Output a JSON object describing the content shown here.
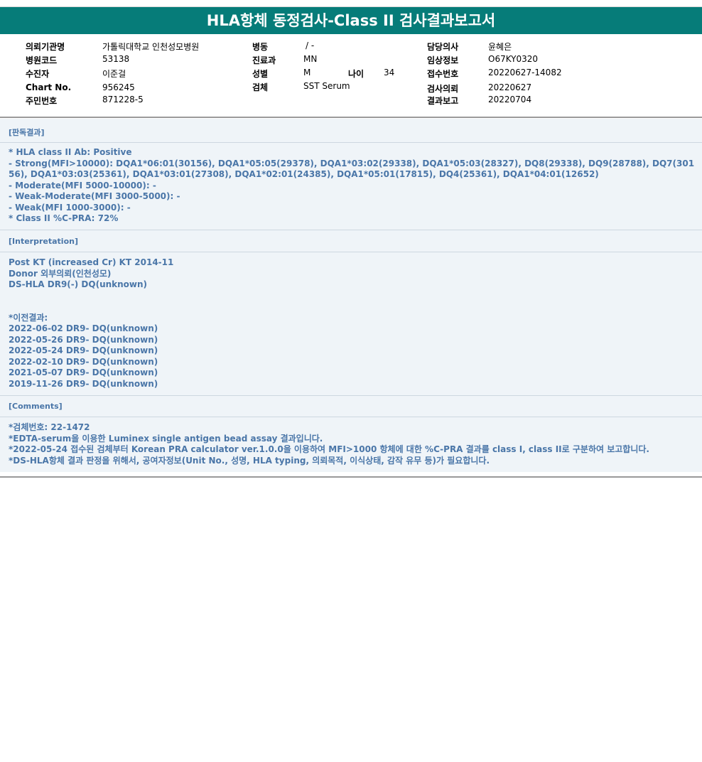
{
  "title": "HLA항체 동정검사-Class II 검사결과보고서",
  "header": {
    "col1": [
      {
        "label": "의뢰기관명",
        "value": "가톨릭대학교 인천성모병원"
      },
      {
        "label": "병원코드",
        "value": "53138"
      },
      {
        "label": "수진자",
        "value": "이준걸"
      },
      {
        "label": "Chart No.",
        "value": "956245"
      },
      {
        "label": "주민번호",
        "value": "871228-5"
      }
    ],
    "col2": [
      {
        "label": "병동",
        "value": "/ -"
      },
      {
        "label": "진료과",
        "value": "MN"
      },
      {
        "label": "성별",
        "value": "M"
      },
      {
        "label": "검체",
        "value": "SST Serum"
      }
    ],
    "age": {
      "label": "나이",
      "value": "34"
    },
    "col3": [
      {
        "label": "담당의사",
        "value": "윤혜은"
      },
      {
        "label": "임상정보",
        "value": "O67KY0320"
      },
      {
        "label": "접수번호",
        "value": "20220627-14082"
      },
      {
        "label": "검사의뢰",
        "value": "20220627"
      },
      {
        "label": "결과보고",
        "value": "20220704"
      }
    ]
  },
  "sections": {
    "result": {
      "title": "[판독결과]",
      "body": "* HLA class II Ab: Positive\n- Strong(MFI>10000): DQA1*06:01(30156), DQA1*05:05(29378), DQA1*03:02(29338), DQA1*05:03(28327), DQ8(29338), DQ9(28788), DQ7(30156), DQA1*03:03(25361), DQA1*03:01(27308), DQA1*02:01(24385), DQA1*05:01(17815), DQ4(25361), DQA1*04:01(12652)\n- Moderate(MFI 5000-10000): -\n- Weak-Moderate(MFI 3000-5000): -\n- Weak(MFI 1000-3000): -\n* Class II %C-PRA: 72%"
    },
    "interpretation": {
      "title": "[Interpretation]",
      "body": "Post KT (increased Cr) KT 2014-11\nDonor 외부의뢰(인천성모)\nDS-HLA DR9(-) DQ(unknown)\n\n\n*이전결과:\n2022-06-02 DR9- DQ(unknown)\n2022-05-26 DR9- DQ(unknown)\n2022-05-24 DR9- DQ(unknown)\n2022-02-10 DR9- DQ(unknown)\n2021-05-07 DR9- DQ(unknown)\n2019-11-26 DR9- DQ(unknown)"
    },
    "comments": {
      "title": "[Comments]",
      "body": "*검체번호: 22-1472\n*EDTA-serum을 이용한 Luminex single antigen bead assay 결과입니다.\n*2022-05-24 접수된 검체부터 Korean PRA calculator ver.1.0.0을 이용하여 MFI>1000 항체에 대한 %C-PRA 결과를 class I, class II로 구분하여 보고합니다.\n*DS-HLA항체 결과 판정을 위해서, 공여자정보(Unit No., 성명, HLA typing, 의뢰목적, 이식상태, 감작 유무 등)가 필요합니다."
    }
  }
}
